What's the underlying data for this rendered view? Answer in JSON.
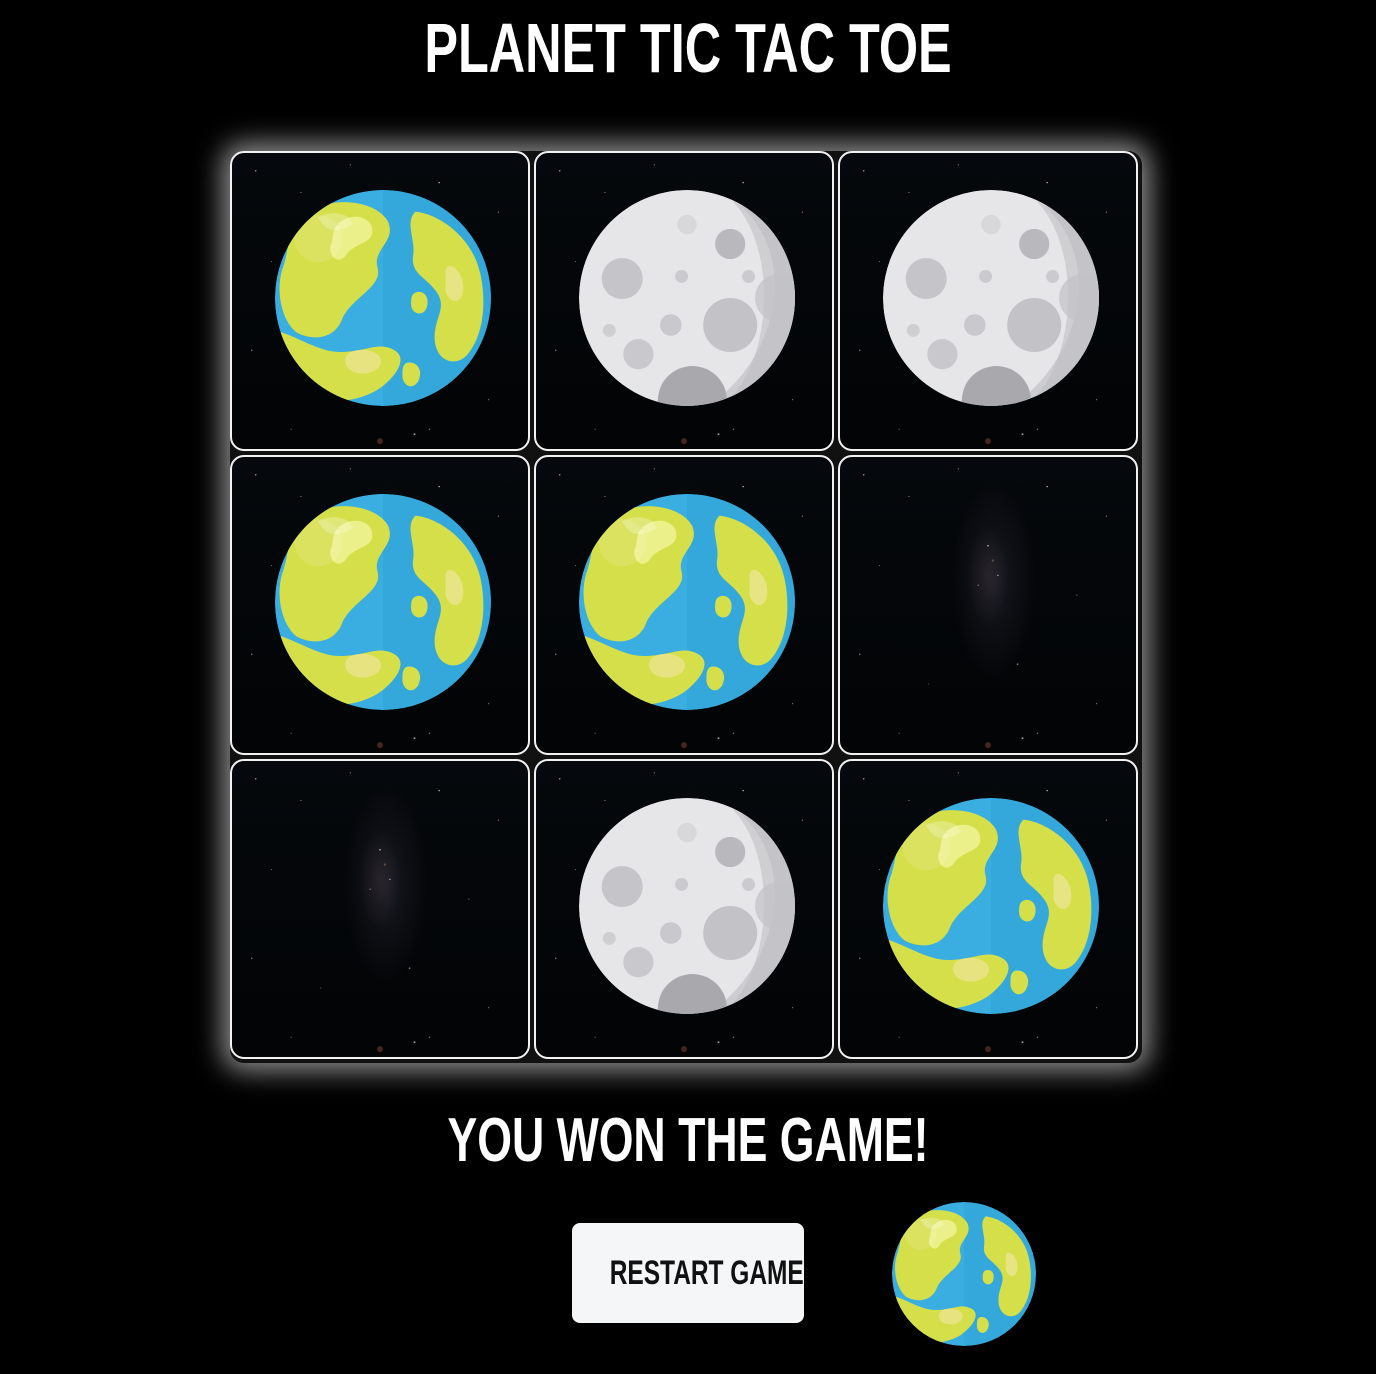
{
  "game": {
    "title": "PLANET TIC TAC TOE",
    "status_message": "YOU WON THE GAME!",
    "restart_label": "RESTART GAME",
    "winner": "earth",
    "board": [
      [
        "earth",
        "moon",
        "moon"
      ],
      [
        "earth",
        "earth",
        ""
      ],
      [
        "",
        "moon",
        "earth"
      ]
    ]
  },
  "icons": {
    "earth": "earth-planet-icon",
    "moon": "moon-icon"
  },
  "colors": {
    "background": "#000000",
    "ocean": "#3aaee0",
    "land": "#d5df4a",
    "moon": "#e6e6e8",
    "crater": "#b9b9bd",
    "button": "#f5f6f8"
  }
}
